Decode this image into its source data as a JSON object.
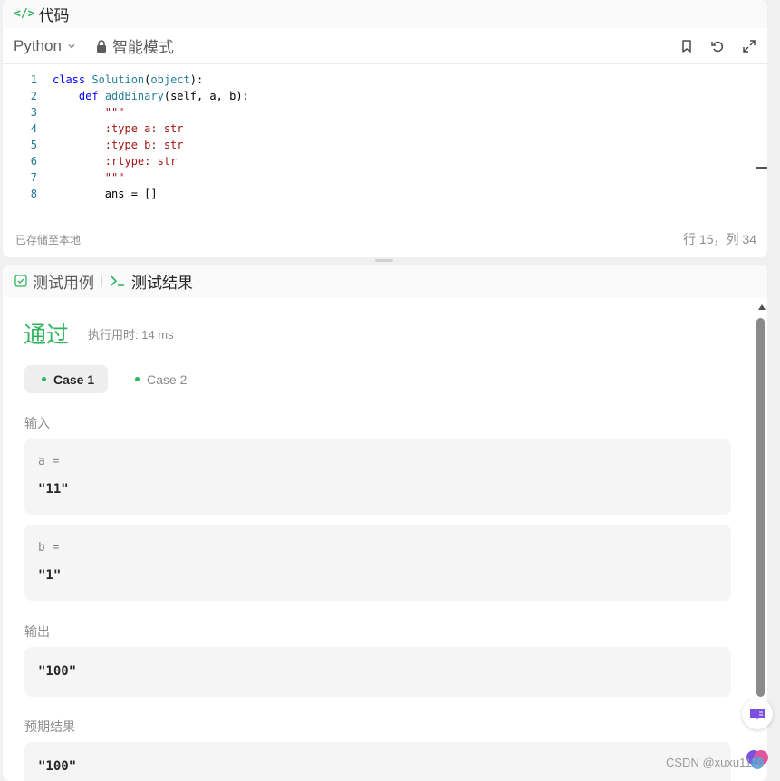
{
  "editor": {
    "header_title": "代码",
    "language": "Python",
    "mode_label": "智能模式",
    "code_lines": [
      {
        "n": "1",
        "segments": [
          {
            "t": "class ",
            "c": "kw"
          },
          {
            "t": "Solution",
            "c": "cls"
          },
          {
            "t": "(",
            "c": ""
          },
          {
            "t": "object",
            "c": "cls"
          },
          {
            "t": "):",
            "c": ""
          }
        ]
      },
      {
        "n": "2",
        "segments": [
          {
            "t": "    ",
            "c": ""
          },
          {
            "t": "def ",
            "c": "kw"
          },
          {
            "t": "addBinary",
            "c": "cls"
          },
          {
            "t": "(self, a, b):",
            "c": ""
          }
        ]
      },
      {
        "n": "3",
        "segments": [
          {
            "t": "        \"\"\"",
            "c": "str"
          }
        ]
      },
      {
        "n": "4",
        "segments": [
          {
            "t": "        :type a: str",
            "c": "str"
          }
        ]
      },
      {
        "n": "5",
        "segments": [
          {
            "t": "        :type b: str",
            "c": "str"
          }
        ]
      },
      {
        "n": "6",
        "segments": [
          {
            "t": "        :rtype: str",
            "c": "str"
          }
        ]
      },
      {
        "n": "7",
        "segments": [
          {
            "t": "        \"\"\"",
            "c": "str"
          }
        ]
      },
      {
        "n": "8",
        "segments": [
          {
            "t": "        ans = []",
            "c": ""
          }
        ]
      }
    ],
    "saved_status": "已存储至本地",
    "cursor_position": "行 15，列 34"
  },
  "results": {
    "tabs": [
      {
        "label": "测试用例",
        "icon": "checkbox-icon",
        "active": false
      },
      {
        "label": "测试结果",
        "icon": "terminal-icon",
        "active": true
      }
    ],
    "status": "通过",
    "runtime": "执行用时: 14 ms",
    "cases": [
      "Case 1",
      "Case 2"
    ],
    "input_label": "输入",
    "inputs": [
      {
        "name": "a =",
        "value": "\"11\""
      },
      {
        "name": "b =",
        "value": "\"1\""
      }
    ],
    "output_label": "输出",
    "output_value": "\"100\"",
    "expected_label": "预期结果",
    "expected_value": "\"100\""
  },
  "watermark": "CSDN @xuxu1116",
  "colors": {
    "accent_green": "#2db55d",
    "fab_purple": "#7b4fe0"
  }
}
